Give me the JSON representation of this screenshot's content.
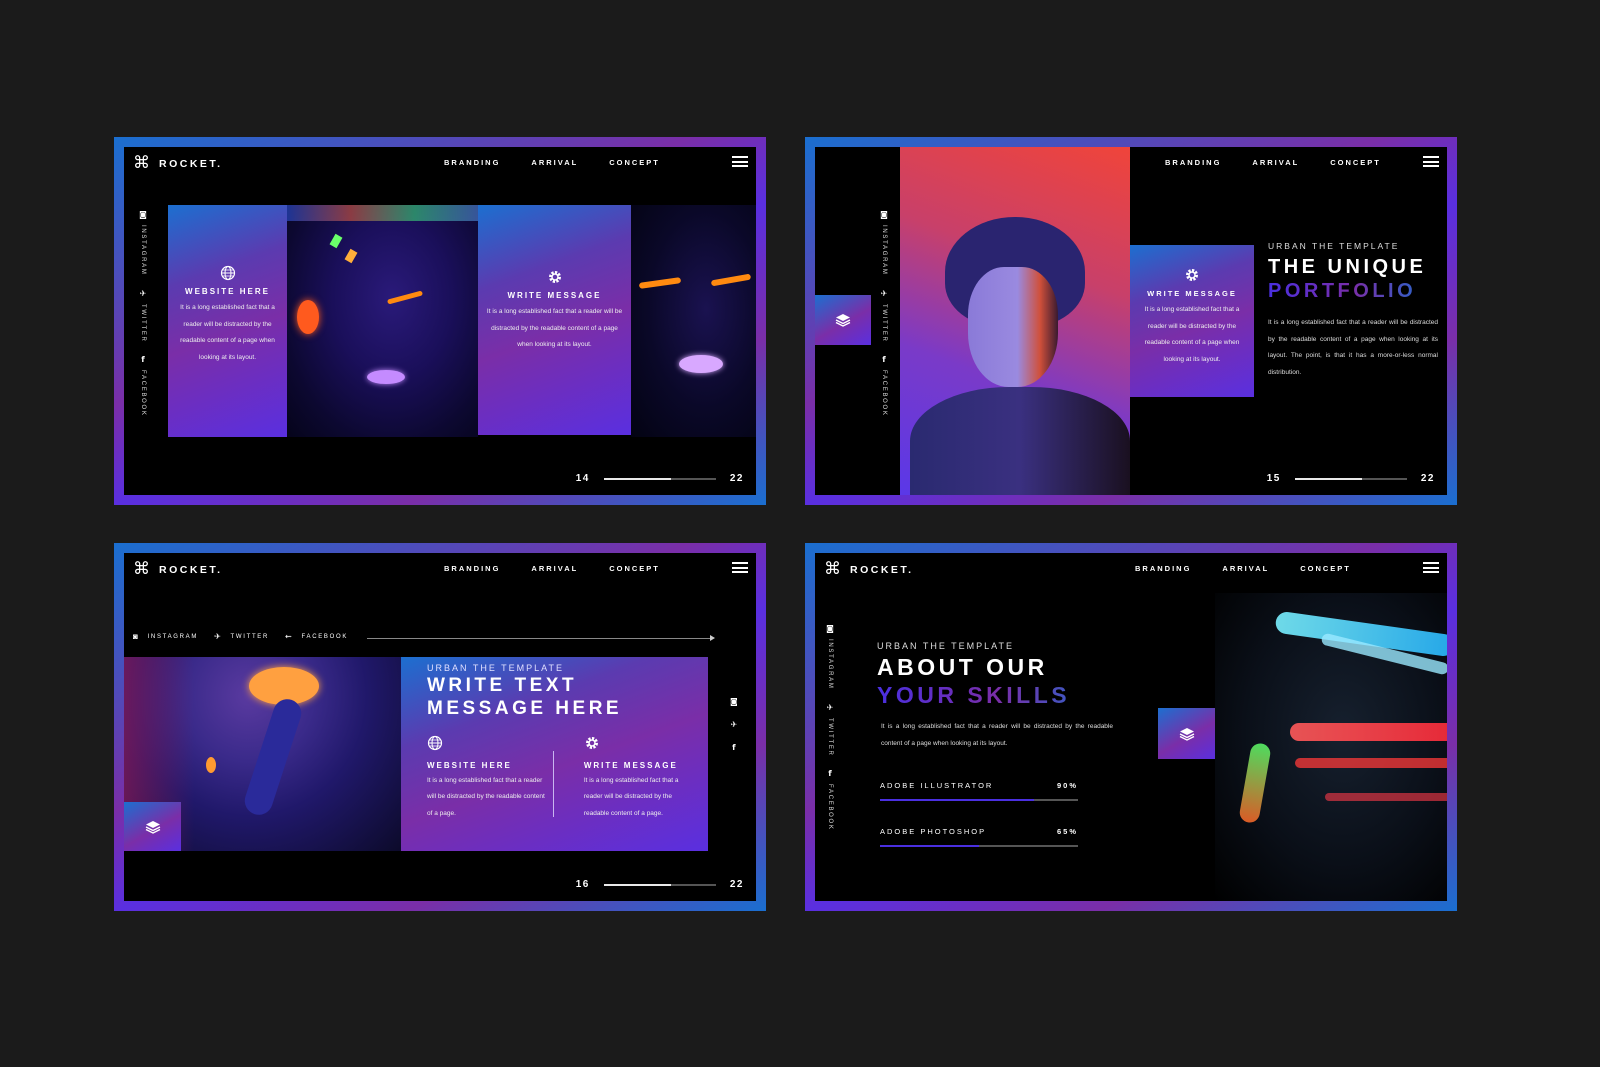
{
  "brand": {
    "logo_icon": "command-key-icon",
    "name": "ROCKET."
  },
  "nav": {
    "items": [
      "BRANDING",
      "ARRIVAL",
      "CONCEPT"
    ],
    "menu_icon": "hamburger-menu-icon"
  },
  "social": [
    {
      "icon": "instagram-icon",
      "label": "INSTAGRAM"
    },
    {
      "icon": "twitter-icon",
      "label": "TWITTER"
    },
    {
      "icon": "facebook-icon",
      "label": "FACEBOOK"
    }
  ],
  "colors": {
    "blue": "#1a6fd0",
    "purple": "#7a2ea8",
    "violet": "#5a2fe0",
    "background": "#1b1b1b",
    "slide_bg": "#000000"
  },
  "slides": [
    {
      "cards": [
        {
          "icon": "globe-icon",
          "title": "WEBSITE HERE",
          "text": "It is a long established fact that a reader will be distracted by the readable content of a page when looking at its layout."
        },
        {
          "icon": "gear-icon",
          "title": "WRITE MESSAGE",
          "text": "It is a long established fact that a reader will be distracted by the readable content of a page when looking at its layout."
        }
      ],
      "pager": {
        "current": "14",
        "total": "22",
        "progress": 0.6
      }
    },
    {
      "eyebrow": "URBAN THE TEMPLATE",
      "headline_1": "THE UNIQUE",
      "headline_2": "PORTFOLIO",
      "body": "It is a long established fact that a reader will be distracted by the readable content of a page when looking at its layout. The point, is that it has a more-or-less normal distribution.",
      "card": {
        "icon": "gear-icon",
        "title": "WRITE MESSAGE",
        "text": "It is a long established fact that a reader will be distracted by the readable content of a page when looking at its layout."
      },
      "pager": {
        "current": "15",
        "total": "22",
        "progress": 0.6
      }
    },
    {
      "eyebrow": "URBAN THE TEMPLATE",
      "headline_1": "WRITE TEXT",
      "headline_2": "MESSAGE HERE",
      "columns": [
        {
          "icon": "globe-icon",
          "title": "WEBSITE HERE",
          "text": "It is a long established fact that a reader will be distracted by the readable content of a page."
        },
        {
          "icon": "gear-icon",
          "title": "WRITE MESSAGE",
          "text": "It is a long established fact that a reader will be distracted by the readable content of a page."
        }
      ],
      "pager": {
        "current": "16",
        "total": "22",
        "progress": 0.6
      }
    },
    {
      "eyebrow": "URBAN THE TEMPLATE",
      "headline_1": "ABOUT OUR",
      "headline_2": "YOUR SKILLS",
      "body": "It is a long established fact that a reader will be distracted by the readable content of a page when looking at its layout.",
      "skills": [
        {
          "name": "ADOBE ILLUSTRATOR",
          "value_label": "90%",
          "value": 0.78
        },
        {
          "name": "ADOBE PHOTOSHOP",
          "value_label": "65%",
          "value": 0.5
        }
      ]
    }
  ]
}
